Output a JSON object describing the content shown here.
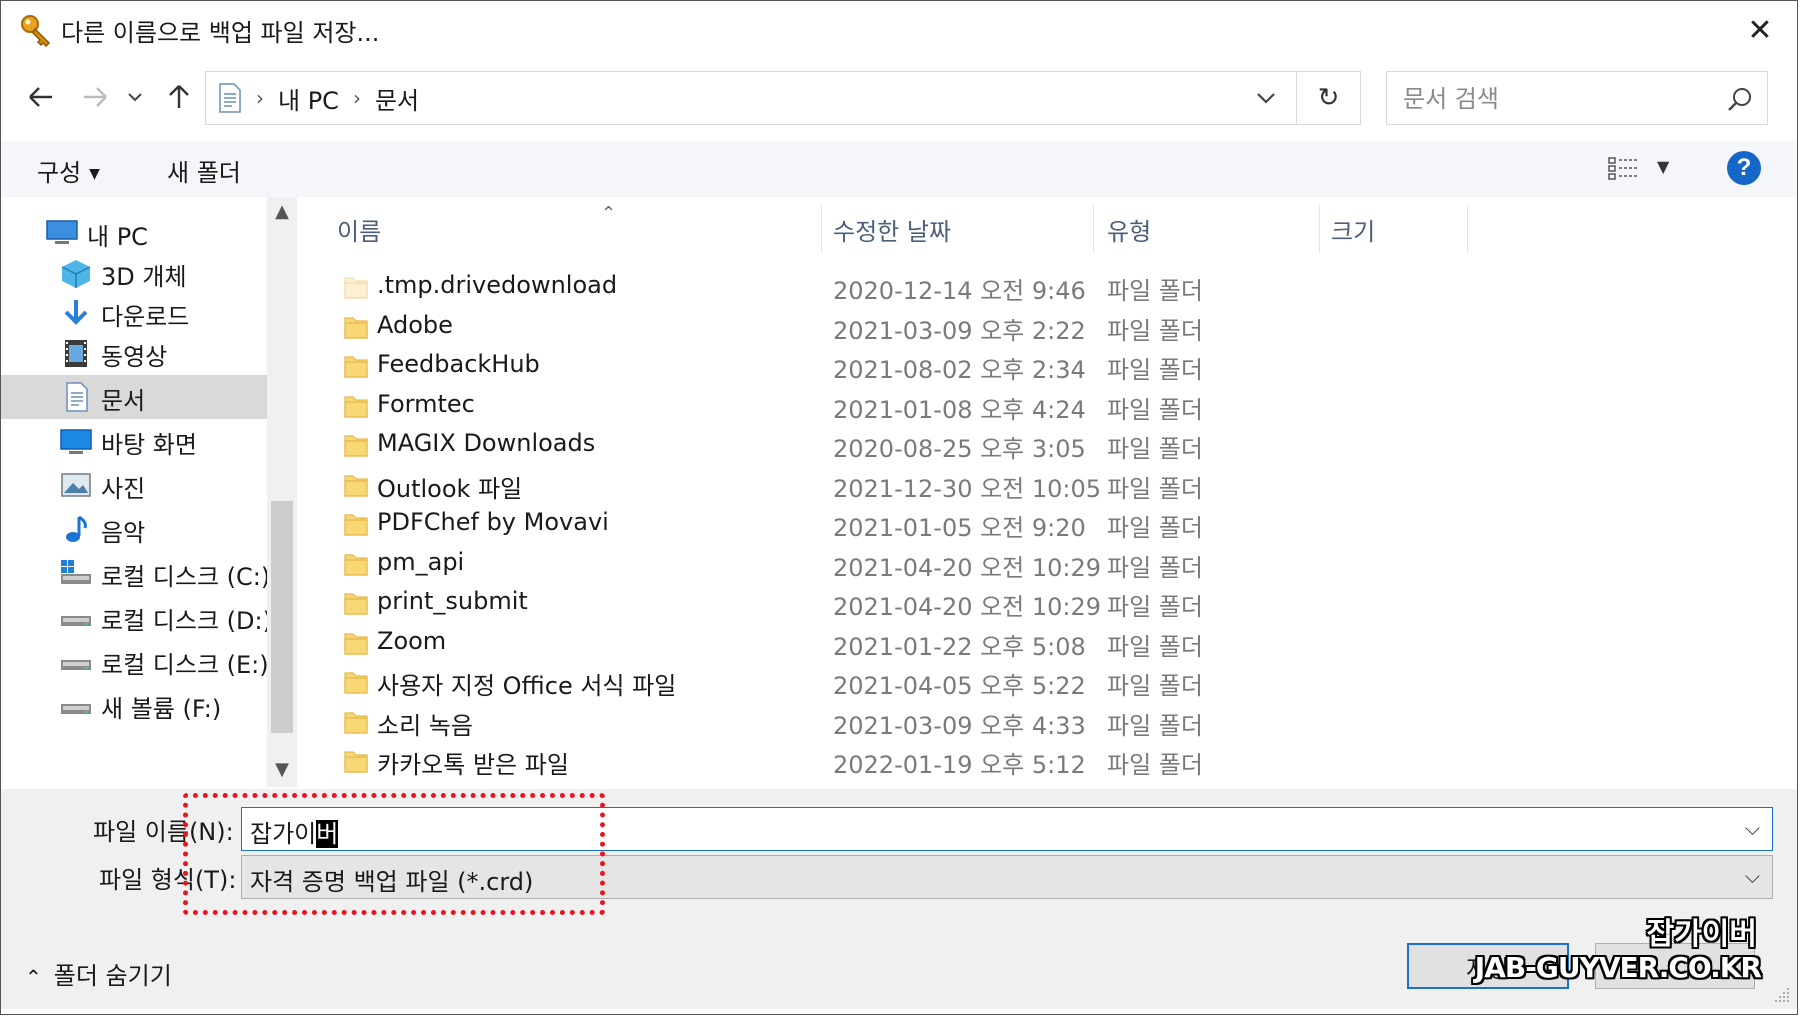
{
  "window": {
    "title": "다른 이름으로 백업 파일 저장...",
    "close_glyph": "✕"
  },
  "address": {
    "crumbs": [
      "내 PC",
      "문서"
    ],
    "search_placeholder": "문서 검색"
  },
  "toolbar": {
    "organize_label": "구성",
    "new_folder_label": "새 폴더",
    "help_label": "?"
  },
  "nav": {
    "items": [
      {
        "label": "내 PC",
        "icon": "pc-icon"
      },
      {
        "label": "3D 개체",
        "icon": "3d-objects-icon"
      },
      {
        "label": "다운로드",
        "icon": "download-icon"
      },
      {
        "label": "동영상",
        "icon": "video-icon"
      },
      {
        "label": "문서",
        "icon": "document-icon",
        "selected": true
      },
      {
        "label": "바탕 화면",
        "icon": "desktop-icon"
      },
      {
        "label": "사진",
        "icon": "pictures-icon"
      },
      {
        "label": "음악",
        "icon": "music-icon"
      },
      {
        "label": "로컬 디스크 (C:)",
        "icon": "system-drive-icon"
      },
      {
        "label": "로컬 디스크 (D:)",
        "icon": "drive-icon"
      },
      {
        "label": "로컬 디스크 (E:)",
        "icon": "drive-icon"
      },
      {
        "label": "새 볼륨 (F:)",
        "icon": "drive-icon"
      }
    ]
  },
  "columns": {
    "name": "이름",
    "date": "수정한 날짜",
    "type": "유형",
    "size": "크기"
  },
  "files": [
    {
      "name": ".tmp.drivedownload",
      "date": "2020-12-14 오전 9:46",
      "type": "파일 폴더",
      "hidden": true
    },
    {
      "name": "Adobe",
      "date": "2021-03-09 오후 2:22",
      "type": "파일 폴더"
    },
    {
      "name": "FeedbackHub",
      "date": "2021-08-02 오후 2:34",
      "type": "파일 폴더"
    },
    {
      "name": "Formtec",
      "date": "2021-01-08 오후 4:24",
      "type": "파일 폴더"
    },
    {
      "name": "MAGIX Downloads",
      "date": "2020-08-25 오후 3:05",
      "type": "파일 폴더"
    },
    {
      "name": "Outlook 파일",
      "date": "2021-12-30 오전 10:05",
      "type": "파일 폴더"
    },
    {
      "name": "PDFChef by Movavi",
      "date": "2021-01-05 오전 9:20",
      "type": "파일 폴더"
    },
    {
      "name": "pm_api",
      "date": "2021-04-20 오전 10:29",
      "type": "파일 폴더"
    },
    {
      "name": "print_submit",
      "date": "2021-04-20 오전 10:29",
      "type": "파일 폴더"
    },
    {
      "name": "Zoom",
      "date": "2021-01-22 오후 5:08",
      "type": "파일 폴더"
    },
    {
      "name": "사용자 지정 Office 서식 파일",
      "date": "2021-04-05 오후 5:22",
      "type": "파일 폴더"
    },
    {
      "name": "소리 녹음",
      "date": "2021-03-09 오후 4:33",
      "type": "파일 폴더"
    },
    {
      "name": "카카오톡 받은 파일",
      "date": "2022-01-19 오후 5:12",
      "type": "파일 폴더"
    }
  ],
  "form": {
    "filename_label": "파일 이름(N):",
    "filename_value_prefix": "잡가이",
    "filename_value_cursor": "버",
    "filetype_label": "파일 형식(T):",
    "filetype_value": "자격 증명 백업 파일 (*.crd)"
  },
  "footer": {
    "hide_folders_label": "폴더 숨기기",
    "save_label": "저장"
  },
  "watermark": {
    "line1": "잡가이버",
    "line2": "JAB-GUYVER.CO.KR"
  },
  "colors": {
    "accent": "#1a6fd0",
    "annotation_red": "#e8141f",
    "folder_yellow": "#f8d775"
  }
}
